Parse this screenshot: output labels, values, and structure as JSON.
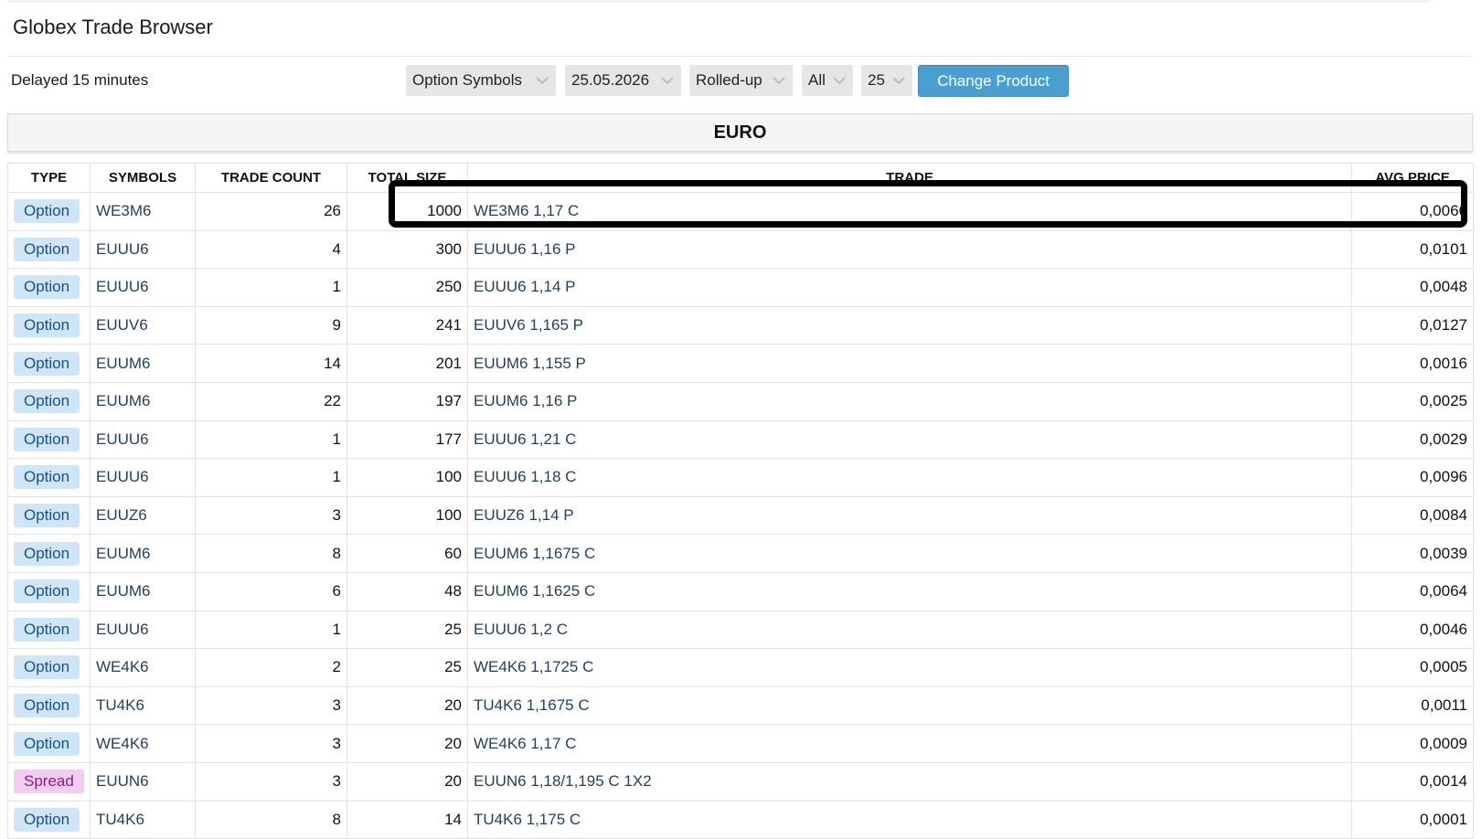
{
  "app": {
    "title": "Globex Trade Browser"
  },
  "status": {
    "delay_text": "Delayed 15 minutes"
  },
  "filters": {
    "symbol_view": "Option Symbols",
    "date": "25.05.2026",
    "aggregation": "Rolled-up",
    "type_filter": "All",
    "row_limit": "25",
    "change_product_label": "Change Product"
  },
  "product": {
    "name": "EURO"
  },
  "table": {
    "headers": {
      "type": "TYPE",
      "symbols": "SYMBOLS",
      "trade_count": "TRADE COUNT",
      "total_size": "TOTAL SIZE",
      "trade": "TRADE",
      "avg_price": "AVG PRICE"
    },
    "rows": [
      {
        "type": "Option",
        "symbol": "WE3M6",
        "count": "26",
        "size": "1000",
        "trade": "WE3M6 1,17 C",
        "avg": "0,0066"
      },
      {
        "type": "Option",
        "symbol": "EUUU6",
        "count": "4",
        "size": "300",
        "trade": "EUUU6 1,16 P",
        "avg": "0,0101"
      },
      {
        "type": "Option",
        "symbol": "EUUU6",
        "count": "1",
        "size": "250",
        "trade": "EUUU6 1,14 P",
        "avg": "0,0048"
      },
      {
        "type": "Option",
        "symbol": "EUUV6",
        "count": "9",
        "size": "241",
        "trade": "EUUV6 1,165 P",
        "avg": "0,0127"
      },
      {
        "type": "Option",
        "symbol": "EUUM6",
        "count": "14",
        "size": "201",
        "trade": "EUUM6 1,155 P",
        "avg": "0,0016"
      },
      {
        "type": "Option",
        "symbol": "EUUM6",
        "count": "22",
        "size": "197",
        "trade": "EUUM6 1,16 P",
        "avg": "0,0025"
      },
      {
        "type": "Option",
        "symbol": "EUUU6",
        "count": "1",
        "size": "177",
        "trade": "EUUU6 1,21 C",
        "avg": "0,0029"
      },
      {
        "type": "Option",
        "symbol": "EUUU6",
        "count": "1",
        "size": "100",
        "trade": "EUUU6 1,18 C",
        "avg": "0,0096"
      },
      {
        "type": "Option",
        "symbol": "EUUZ6",
        "count": "3",
        "size": "100",
        "trade": "EUUZ6 1,14 P",
        "avg": "0,0084"
      },
      {
        "type": "Option",
        "symbol": "EUUM6",
        "count": "8",
        "size": "60",
        "trade": "EUUM6 1,1675 C",
        "avg": "0,0039"
      },
      {
        "type": "Option",
        "symbol": "EUUM6",
        "count": "6",
        "size": "48",
        "trade": "EUUM6 1,1625 C",
        "avg": "0,0064"
      },
      {
        "type": "Option",
        "symbol": "EUUU6",
        "count": "1",
        "size": "25",
        "trade": "EUUU6 1,2 C",
        "avg": "0,0046"
      },
      {
        "type": "Option",
        "symbol": "WE4K6",
        "count": "2",
        "size": "25",
        "trade": "WE4K6 1,1725 C",
        "avg": "0,0005"
      },
      {
        "type": "Option",
        "symbol": "TU4K6",
        "count": "3",
        "size": "20",
        "trade": "TU4K6 1,1675 C",
        "avg": "0,0011"
      },
      {
        "type": "Option",
        "symbol": "WE4K6",
        "count": "3",
        "size": "20",
        "trade": "WE4K6 1,17 C",
        "avg": "0,0009"
      },
      {
        "type": "Spread",
        "symbol": "EUUN6",
        "count": "3",
        "size": "20",
        "trade": "EUUN6 1,18/1,195 C 1X2",
        "avg": "0,0014"
      },
      {
        "type": "Option",
        "symbol": "TU4K6",
        "count": "8",
        "size": "14",
        "trade": "TU4K6 1,175 C",
        "avg": "0,0001"
      }
    ]
  },
  "icons": {
    "dropdown": "chevron-down-icon"
  },
  "colors": {
    "accent_button": "#4a9fd0",
    "option_badge": "#cfe6f8",
    "spread_badge": "#f3cdef",
    "highlight_border": "#000000"
  }
}
